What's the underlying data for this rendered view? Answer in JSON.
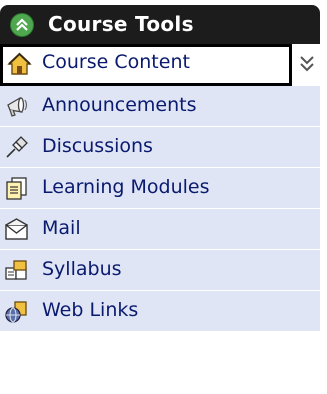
{
  "header": {
    "title": "Course Tools",
    "collapse_icon": "double-chevron-up-icon"
  },
  "items": [
    {
      "label": "Course Content",
      "icon": "home-icon",
      "active": true
    },
    {
      "label": "Announcements",
      "icon": "megaphone-icon"
    },
    {
      "label": "Discussions",
      "icon": "pushpin-icon"
    },
    {
      "label": "Learning Modules",
      "icon": "document-icon"
    },
    {
      "label": "Mail",
      "icon": "envelope-icon"
    },
    {
      "label": "Syllabus",
      "icon": "open-book-icon"
    },
    {
      "label": "Web Links",
      "icon": "globe-link-icon"
    }
  ],
  "expand_icon": "double-chevron-down-icon",
  "colors": {
    "header_bg": "#1c1c1c",
    "item_bg": "#dfe5f5",
    "label_text": "#0a1a6e",
    "collapse_button": "#4fa84f"
  }
}
